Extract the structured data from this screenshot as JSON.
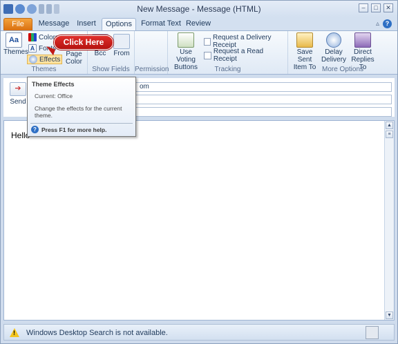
{
  "window": {
    "title": "New Message - Message (HTML)",
    "controls": {
      "minimize": "–",
      "maximize": "□",
      "close": "✕"
    }
  },
  "tabs": [
    {
      "label": "File"
    },
    {
      "label": "Message"
    },
    {
      "label": "Insert"
    },
    {
      "label": "Options"
    },
    {
      "label": "Format Text"
    },
    {
      "label": "Review"
    }
  ],
  "ribbon": {
    "themes_group": {
      "label": "Themes",
      "themes_button": "Themes",
      "colors": "Colors",
      "fonts": "Fonts",
      "effects": "Effects",
      "page_color_line1": "Page",
      "page_color_line2": "Color"
    },
    "show_fields_group": {
      "label": "Show Fields",
      "bcc": "Bcc",
      "from": "From"
    },
    "permission_group": {
      "label": "Permission"
    },
    "tracking_group": {
      "label": "Tracking",
      "voting_line1": "Use Voting",
      "voting_line2": "Buttons",
      "delivery_receipt": "Request a Delivery Receipt",
      "read_receipt": "Request a Read Receipt"
    },
    "more_options_group": {
      "label": "More Options",
      "save_sent_line1": "Save Sent",
      "save_sent_line2": "Item To",
      "delay_line1": "Delay",
      "delay_line2": "Delivery",
      "direct_line1": "Direct",
      "direct_line2": "Replies To"
    }
  },
  "callout": {
    "text": "Click Here"
  },
  "tooltip": {
    "title": "Theme Effects",
    "current": "Current: Office",
    "description": "Change the effects for the current theme.",
    "help": "Press F1 for more help."
  },
  "message": {
    "send_label": "Send",
    "to_value": "om",
    "body_text": "Hello"
  },
  "status": {
    "text": "Windows Desktop Search is not available."
  },
  "colors": {
    "accent": "#2e6fc4",
    "file_tab": "#d96f10",
    "callout": "#c11a16"
  }
}
